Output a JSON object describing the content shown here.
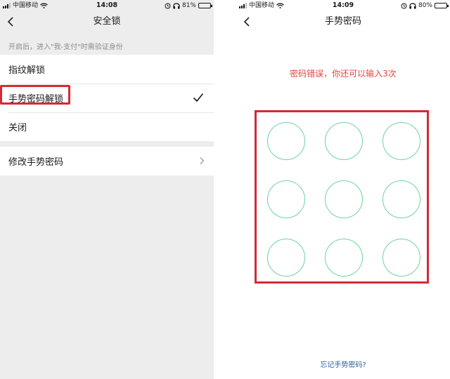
{
  "left": {
    "status": {
      "carrier": "中国移动",
      "time": "14:08",
      "battery": "81%",
      "battery_level": 0.81
    },
    "nav": {
      "title": "安全锁"
    },
    "hint": "开启后，进入\"我-支付\"时需验证身份",
    "options": [
      {
        "label": "指纹解锁",
        "selected": false
      },
      {
        "label": "手势密码解锁",
        "selected": true
      },
      {
        "label": "关闭",
        "selected": false
      }
    ],
    "modify": {
      "label": "修改手势密码"
    }
  },
  "right": {
    "status": {
      "carrier": "中国移动",
      "time": "14:09",
      "battery": "80%",
      "battery_level": 0.8
    },
    "nav": {
      "title": "手势密码"
    },
    "error": "密码错误，你还可以输入3次",
    "grid": {
      "rows": 3,
      "cols": 3
    },
    "forgot": "忘记手势密码?"
  },
  "colors": {
    "highlight": "#d42a34",
    "error": "#e0453a",
    "dot": "#6fd2a4",
    "link": "#2e5f96",
    "left_bg": "#ededed"
  },
  "icons": [
    "signal-icon",
    "wifi-icon",
    "battery-icon",
    "back-chevron-icon",
    "checkmark-icon",
    "chevron-right-icon",
    "alarm-icon",
    "headphones-icon"
  ]
}
